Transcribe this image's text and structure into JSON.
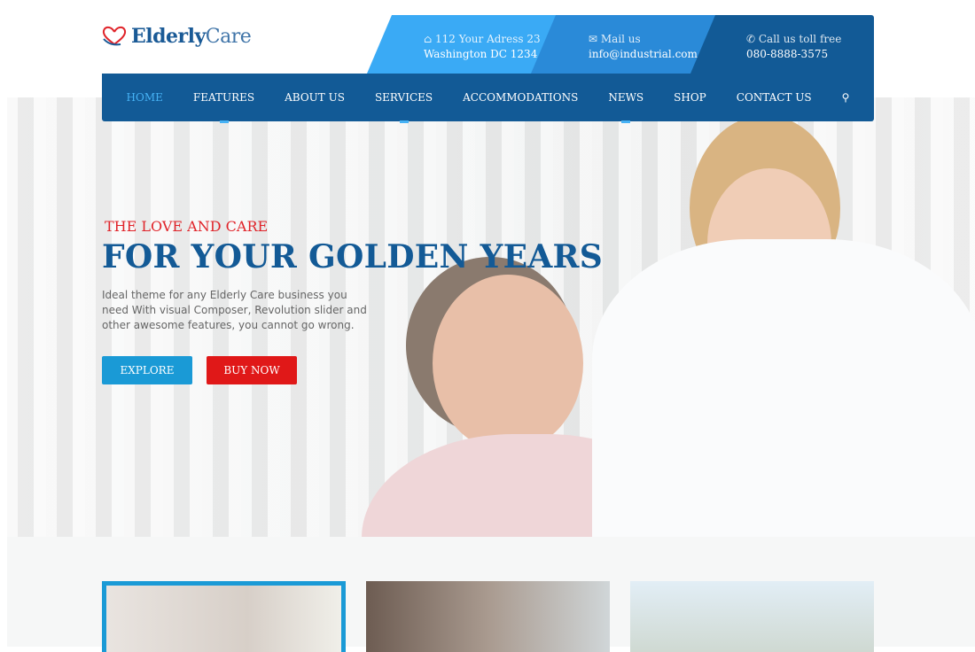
{
  "logo": {
    "text_bold": "Elderly",
    "text_light": "Care"
  },
  "contact": [
    {
      "icon": "home-icon",
      "line1": "112 Your Adress 23",
      "line2": "Washington DC 1234"
    },
    {
      "icon": "mail-icon",
      "line1": "Mail us",
      "line2": "info@industrial.com"
    },
    {
      "icon": "phone-icon",
      "line1": "Call us toll free",
      "line2": "080-8888-3575"
    }
  ],
  "nav": [
    "HOME",
    "FEATURES",
    "ABOUT US",
    "SERVICES",
    "ACCOMMODATIONS",
    "NEWS",
    "SHOP",
    "CONTACT US"
  ],
  "nav_active": "HOME",
  "hero": {
    "subtitle": "THE LOVE AND CARE",
    "title": "FOR YOUR GOLDEN YEARS",
    "description": "Ideal theme for any Elderly Care business you need With visual Composer, Revolution slider and other awesome features, you cannot go wrong.",
    "explore": "EXPLORE",
    "buy": "BUY NOW"
  },
  "colors": {
    "primary": "#125a96",
    "accent": "#3aaaf5",
    "red": "#e01818"
  }
}
